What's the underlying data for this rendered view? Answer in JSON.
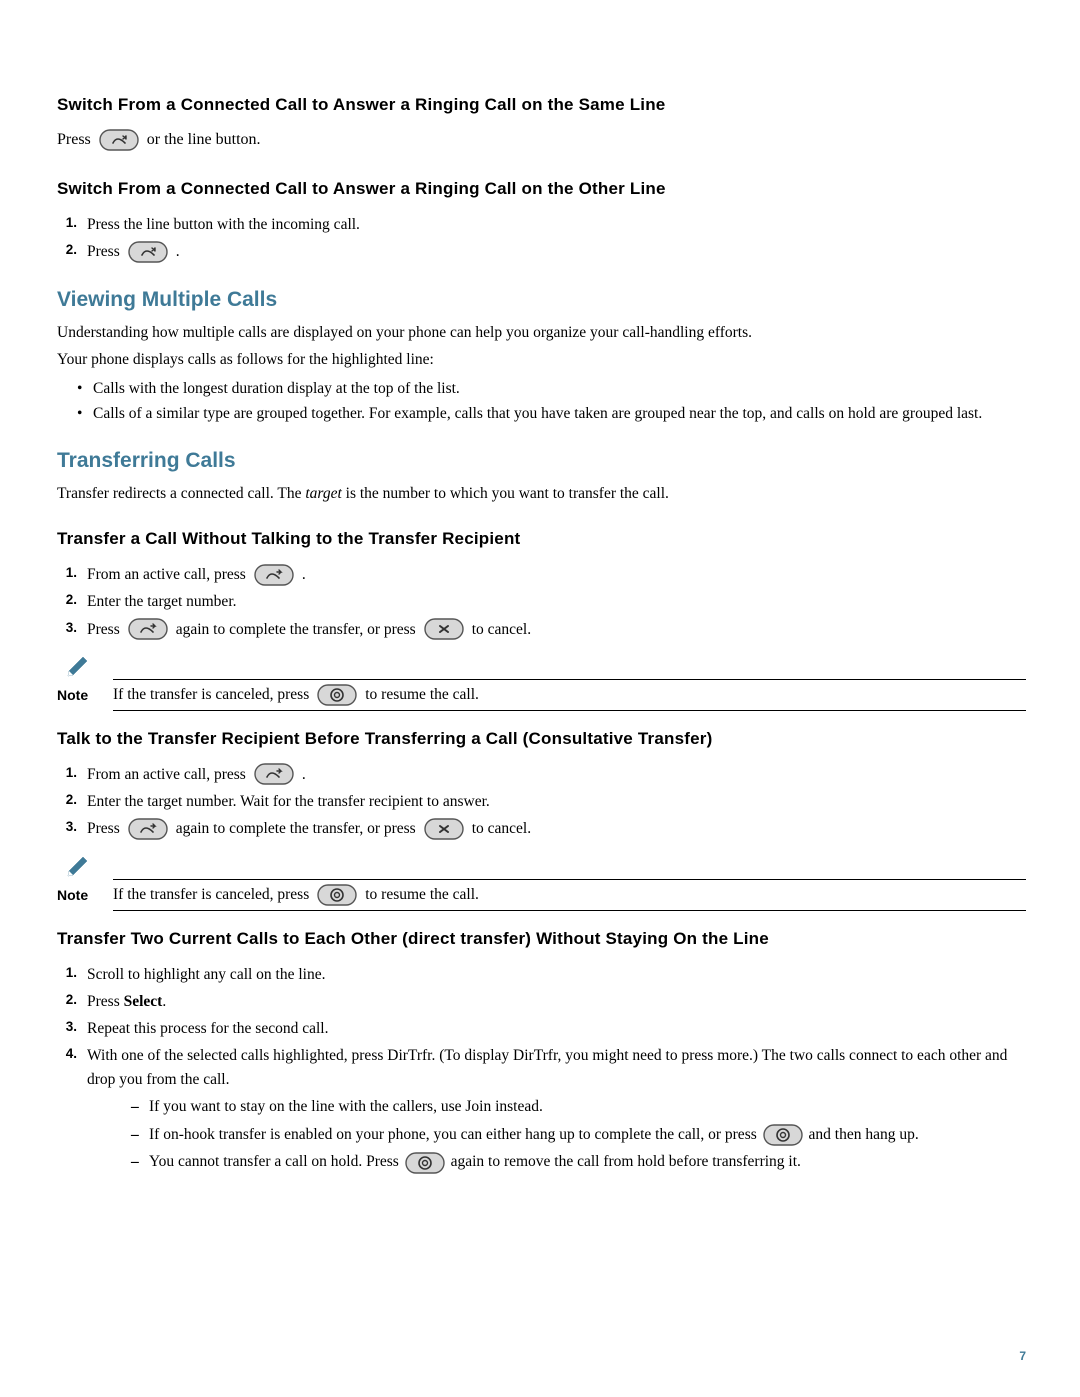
{
  "page_number": "7",
  "icons": {
    "answer": "answer-icon",
    "transfer": "transfer-icon",
    "cancel": "cancel-icon",
    "hold": "hold-icon",
    "pencil": "pencil-note-icon"
  },
  "s1": {
    "heading": "Switch From a Connected Call to Answer a Ringing Call on the Same Line",
    "press": "Press",
    "orline": "or the line button."
  },
  "s2": {
    "heading": "Switch From a Connected Call to Answer a Ringing Call on the Other Line",
    "item1": "Press the line button with the incoming call.",
    "item2a": "Press",
    "item2b": "."
  },
  "s3": {
    "heading": "Viewing Multiple Calls",
    "p1": "Understanding how multiple calls are displayed on your phone can help you organize your call-handling efforts.",
    "p2": "Your phone displays calls as follows for the highlighted line:",
    "b1": "Calls with the longest duration display at the top of the list.",
    "b2": "Calls of a similar type are grouped together. For example, calls that you have taken are grouped near the top, and calls on hold are grouped last."
  },
  "s4": {
    "heading": "Transferring Calls",
    "p_a": "Transfer redirects a connected call. The ",
    "p_target": "target",
    "p_b": " is the number to which you want to transfer the call."
  },
  "s5": {
    "heading": "Transfer a Call Without Talking to the Transfer Recipient",
    "i1a": "From an active call, press",
    "i1b": ".",
    "i2": "Enter the target number.",
    "i3a": "Press",
    "i3b": "again to complete the transfer, or press",
    "i3c": "to cancel.",
    "note_label": "Note",
    "note_a": "If the transfer is canceled, press",
    "note_b": "to resume the call."
  },
  "s6": {
    "heading": "Talk to the Transfer Recipient Before Transferring a Call (Consultative Transfer)",
    "i1a": "From an active call, press",
    "i1b": ".",
    "i2": "Enter the target number. Wait for the transfer recipient to answer.",
    "i3a": "Press",
    "i3b": "again to complete the transfer, or press",
    "i3c": "to cancel.",
    "note_label": "Note",
    "note_a": "If the transfer is canceled, press",
    "note_b": "to resume the call."
  },
  "s7": {
    "heading": "Transfer Two Current Calls to Each Other (direct transfer) Without Staying On the Line",
    "i1": "Scroll to highlight any call on the line.",
    "i2a": "Press ",
    "i2_select": "Select",
    "i2b": ".",
    "i3": "Repeat this process for the second call.",
    "i4": "With one of the selected calls highlighted, press DirTrfr. (To display DirTrfr, you might need to press more.) The two calls connect to each other and drop you from the call.",
    "d1": "If you want to stay on the line with the callers, use Join instead.",
    "d2a": "If on-hook transfer is enabled on your phone, you can either hang up to complete the call, or press",
    "d2b": "and then hang up.",
    "d3a": "You cannot transfer a call on hold. Press",
    "d3b": "again to remove the call from hold before transferring it."
  }
}
